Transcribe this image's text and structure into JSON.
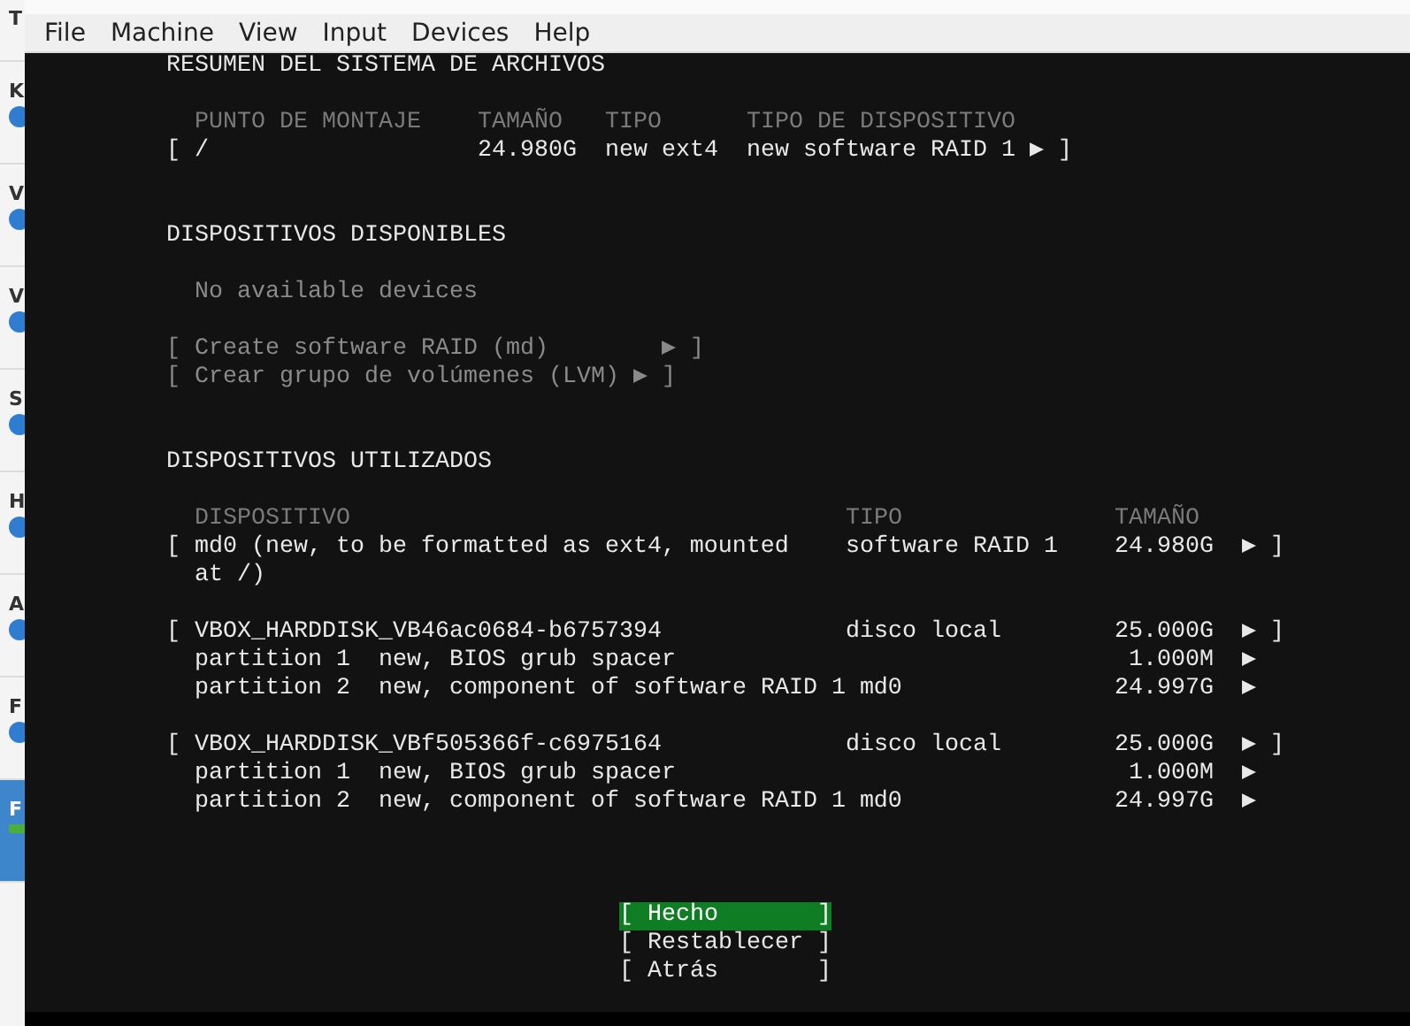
{
  "vm_list": {
    "items": [
      {
        "label": "T",
        "selected": false
      },
      {
        "label": "K",
        "selected": false
      },
      {
        "label": "V",
        "selected": false
      },
      {
        "label": "V",
        "selected": false
      },
      {
        "label": "S",
        "selected": false
      },
      {
        "label": "H",
        "selected": false
      },
      {
        "label": "A",
        "selected": false
      },
      {
        "label": "F",
        "selected": false
      },
      {
        "label": "F",
        "selected": true
      }
    ]
  },
  "menu_bar": {
    "items": [
      "File",
      "Machine",
      "View",
      "Input",
      "Devices",
      "Help"
    ]
  },
  "filesystem_summary": {
    "title": "RESUMEN DEL SISTEMA DE ARCHIVOS",
    "columns": [
      "PUNTO DE MONTAJE",
      "TAMAÑO",
      "TIPO",
      "TIPO DE DISPOSITIVO"
    ],
    "rows": [
      {
        "open": "[",
        "mount_point": "/",
        "size": "24.980G",
        "type": "new ext4",
        "device_type": "new software RAID 1",
        "arrow": "▶",
        "close": "]"
      }
    ]
  },
  "available_devices": {
    "title": "DISPOSITIVOS DISPONIBLES",
    "message": "No available devices",
    "actions": [
      {
        "open": "[",
        "label": "Create software RAID (md)",
        "arrow": "▶",
        "close": "]",
        "disabled": true
      },
      {
        "open": "[",
        "label": "Crear grupo de volúmenes (LVM)",
        "arrow": "▶",
        "close": "]",
        "disabled": true
      }
    ]
  },
  "used_devices": {
    "title": "DISPOSITIVOS UTILIZADOS",
    "columns": [
      "DISPOSITIVO",
      "TIPO",
      "TAMAÑO"
    ],
    "devices": [
      {
        "open": "[",
        "name": "md0 (new, to be formatted as ext4, mounted at /)",
        "type": "software RAID 1",
        "size": "24.980G",
        "arrow": "▶",
        "close": "]"
      },
      {
        "open": "[",
        "name": "VBOX_HARDDISK_VB46ac0684-b6757394",
        "type": "disco local",
        "size": "25.000G",
        "arrow": "▶",
        "close": "]",
        "partitions": [
          {
            "name": "partition 1",
            "description": "new, BIOS grub spacer",
            "size": "1.000M",
            "arrow": "▶"
          },
          {
            "name": "partition 2",
            "description": "new, component of software RAID 1 md0",
            "size": "24.997G",
            "arrow": "▶"
          }
        ]
      },
      {
        "open": "[",
        "name": "VBOX_HARDDISK_VBf505366f-c6975164",
        "type": "disco local",
        "size": "25.000G",
        "arrow": "▶",
        "close": "]",
        "partitions": [
          {
            "name": "partition 1",
            "description": "new, BIOS grub spacer",
            "size": "1.000M",
            "arrow": "▶"
          },
          {
            "name": "partition 2",
            "description": "new, component of software RAID 1 md0",
            "size": "24.997G",
            "arrow": "▶"
          }
        ]
      }
    ]
  },
  "buttons": [
    {
      "open": "[",
      "label": "Hecho",
      "close": "]",
      "selected": true
    },
    {
      "open": "[",
      "label": "Restablecer",
      "close": "]",
      "selected": false
    },
    {
      "open": "[",
      "label": "Atrás",
      "close": "]",
      "selected": false
    }
  ]
}
